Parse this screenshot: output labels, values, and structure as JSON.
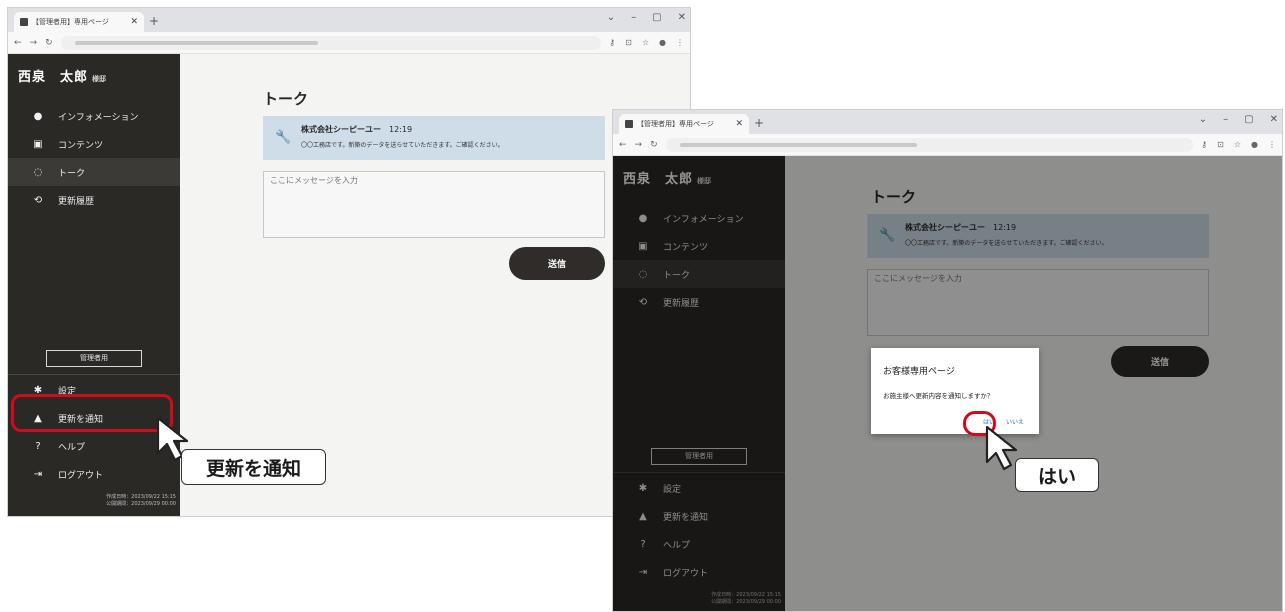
{
  "window1": {
    "tab_title": "【管理者用】専用ページ",
    "user": {
      "name": "西泉　太郎",
      "honorific": "様邸"
    },
    "nav": [
      {
        "label": "インフォメーション",
        "icon": "info-icon"
      },
      {
        "label": "コンテンツ",
        "icon": "image-icon"
      },
      {
        "label": "トーク",
        "icon": "chat-icon"
      },
      {
        "label": "更新履歴",
        "icon": "history-icon"
      }
    ],
    "admin_button": "管理者用",
    "bottom_nav": [
      {
        "label": "設定",
        "icon": "gear-icon"
      },
      {
        "label": "更新を通知",
        "icon": "bell-icon"
      },
      {
        "label": "ヘルプ",
        "icon": "help-icon"
      },
      {
        "label": "ログアウト",
        "icon": "logout-icon"
      }
    ],
    "dates": {
      "created": "作成日時：2023/09/22 15:15",
      "published": "公開期間：2023/09/29 00:00"
    },
    "talk": {
      "title": "トーク",
      "message": {
        "sender": "株式会社シーピーユー",
        "time": "12:19",
        "text": "〇〇工務店です。新築のデータを送らせていただきます。ご確認ください。"
      },
      "input_placeholder": "ここにメッセージを入力",
      "send_label": "送信"
    }
  },
  "window2": {
    "dialog": {
      "title": "お客様専用ページ",
      "message": "お施主様へ更新内容を通知しますか？",
      "yes_label": "はい",
      "no_label": "いいえ"
    }
  },
  "callouts": {
    "notify": "更新を通知",
    "yes": "はい"
  },
  "colors": {
    "sidebar": "#2b2926",
    "accent_highlight": "#d10b1c",
    "message_card": "#cfdde9",
    "link": "#2a66d9"
  }
}
